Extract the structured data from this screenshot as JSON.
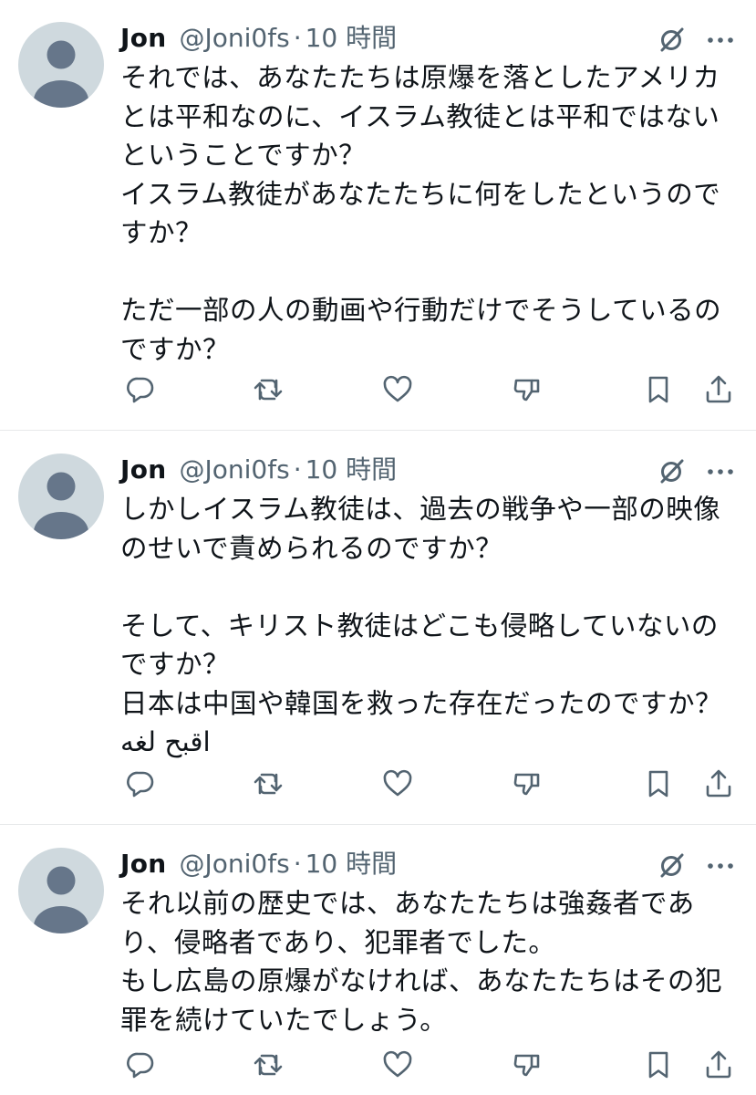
{
  "tweets": [
    {
      "name": "Jon",
      "handle": "@Joni0fs",
      "dot": "·",
      "time": "10 時間",
      "lines": [
        "それでは、あなたたちは原爆を落としたアメリカ",
        "とは平和なのに、イスラム教徒とは平和ではない",
        "ということですか？",
        "イスラム教徒があなたたちに何をしたというので",
        "すか？",
        "",
        "ただ一部の人の動画や行動だけでそうしているの",
        "ですか？"
      ]
    },
    {
      "name": "Jon",
      "handle": "@Joni0fs",
      "dot": "·",
      "time": "10 時間",
      "lines": [
        "しかしイスラム教徒は、過去の戦争や一部の映像",
        "のせいで責められるのですか？",
        "",
        "そして、キリスト教徒はどこも侵略していないの",
        "ですか？",
        "日本は中国や韓国を救った存在だったのですか？",
        "اقبح لغه"
      ]
    },
    {
      "name": "Jon",
      "handle": "@Joni0fs",
      "dot": "·",
      "time": "10 時間",
      "lines": [
        "それ以前の歴史では、あなたたちは強姦者であ",
        "り、侵略者であり、犯罪者でした。",
        "もし広島の原爆がなければ、あなたたちはその犯",
        "罪を続けていたでしょう。"
      ]
    }
  ],
  "icons": {
    "avatar": "default-avatar-icon",
    "grok": "grok-icon",
    "more": "more-icon",
    "reply": "reply-icon",
    "retweet": "retweet-icon",
    "like": "like-icon",
    "dislike": "dislike-icon",
    "bookmark": "bookmark-icon",
    "share": "share-icon"
  },
  "colors": {
    "text": "#0f1419",
    "secondary": "#536471",
    "icon": "#536471",
    "divider": "#e7e9ea",
    "avatar_bg": "#cfd9de",
    "avatar_fg": "#78869a"
  }
}
